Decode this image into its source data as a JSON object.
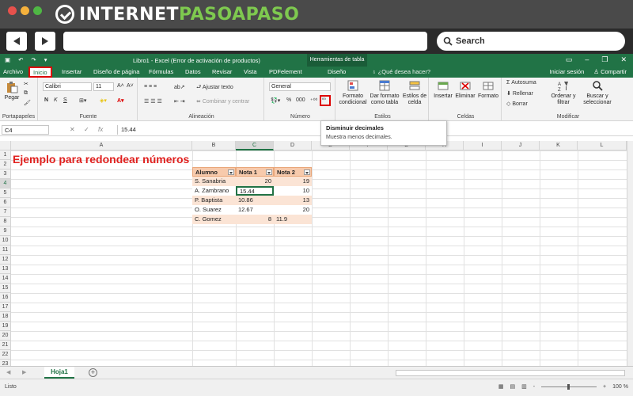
{
  "brand": {
    "name_white": "INTERNET",
    "name_green": "PASOAPASO",
    "colors": {
      "banner": "#4a4a4a",
      "accent": "#7ec94f"
    }
  },
  "browser": {
    "search_label": "Search",
    "dot_colors": [
      "#e7514c",
      "#f5b13c",
      "#4fb744"
    ]
  },
  "excel": {
    "title": "Libro1 - Excel (Error de activación de productos)",
    "tools_tab": "Herramientas de tabla",
    "tabs": [
      "Archivo",
      "Inicio",
      "Insertar",
      "Diseño de página",
      "Fórmulas",
      "Datos",
      "Revisar",
      "Vista",
      "PDFelement",
      "Diseño"
    ],
    "tell_me": "¿Qué desea hacer?",
    "signin": "Iniciar sesión",
    "share": "Compartir",
    "colors": {
      "green": "#217346",
      "highlight": "#dd0000"
    }
  },
  "ribbon": {
    "clipboard": {
      "paste": "Pegar",
      "label": "Portapapeles"
    },
    "font": {
      "name": "Calibri",
      "size": "11",
      "bold": "N",
      "italic": "K",
      "underline": "S",
      "label": "Fuente"
    },
    "alignment": {
      "wrap": "Ajustar texto",
      "merge": "Combinar y centrar",
      "label": "Alineación"
    },
    "number": {
      "format": "General",
      "percent": "%",
      "thousands": "000",
      "label": "Número"
    },
    "styles": {
      "conditional": "Formato condicional",
      "table": "Dar formato como tabla",
      "cell": "Estilos de celda",
      "label": "Estilos"
    },
    "cells": {
      "insert": "Insertar",
      "delete": "Eliminar",
      "format": "Formato",
      "label": "Celdas"
    },
    "editing": {
      "autosum": "Autosuma",
      "fill": "Rellenar",
      "clear": "Borrar",
      "sort": "Ordenar y filtrar",
      "find": "Buscar y seleccionar",
      "label": "Modificar"
    }
  },
  "formula_bar": {
    "cell_ref": "C4",
    "value": "15.44",
    "fx": "fx"
  },
  "tooltip": {
    "title": "Disminuir decimales",
    "body": "Muestra menos decimales."
  },
  "sheet": {
    "columns": [
      "A",
      "B",
      "C",
      "D",
      "E",
      "F",
      "G",
      "H",
      "I",
      "J",
      "K",
      "L"
    ],
    "rows": [
      "1",
      "2",
      "3",
      "4",
      "5",
      "6",
      "7",
      "8",
      "9",
      "10",
      "11",
      "12",
      "13",
      "14",
      "15",
      "16",
      "17",
      "18",
      "19",
      "20",
      "21",
      "22",
      "23"
    ],
    "title": "Ejemplo para redondear números",
    "table_headers": [
      "Alumno",
      "Nota 1",
      "Nota 2"
    ],
    "table_rows": [
      [
        "S. Sanabria",
        "20",
        "19"
      ],
      [
        "A. Zambrano",
        "15.44",
        "10"
      ],
      [
        "P. Baptista",
        "10.86",
        "13"
      ],
      [
        "O. Suarez",
        "12.67",
        "20"
      ],
      [
        "C. Gomez",
        "8",
        "11.9"
      ]
    ],
    "tab_name": "Hoja1",
    "add_sheet": "+"
  },
  "status": {
    "ready": "Listo",
    "zoom": "100 %",
    "minus": "-",
    "plus": "+"
  }
}
